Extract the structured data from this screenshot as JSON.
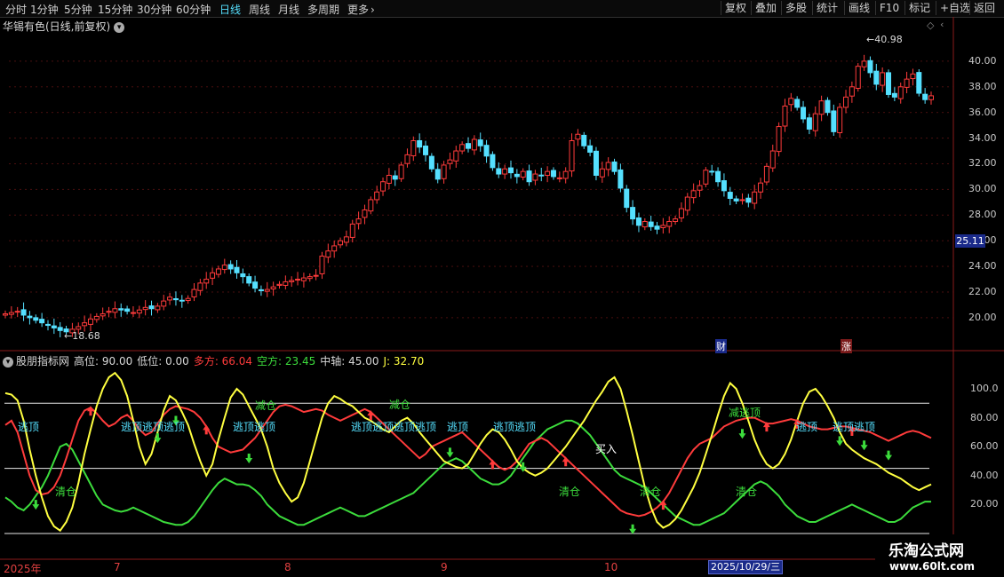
{
  "toolbar": {
    "periods": [
      "分时",
      "1分钟",
      "5分钟",
      "15分钟",
      "30分钟",
      "60分钟",
      "日线",
      "周线",
      "月线",
      "多周期",
      "更多"
    ],
    "active_period": "日线",
    "more_icon": "chevron-right-icon",
    "right_buttons": [
      "复权",
      "叠加",
      "多股",
      "统计",
      "画线",
      "F10",
      "标记",
      "+自选",
      "返回"
    ]
  },
  "stock": {
    "title": "华锡有色(日线,前复权)",
    "high_marker": "40.98",
    "low_marker": "18.68",
    "current_price_tag": "25.11",
    "event_markers": [
      "财",
      "涨"
    ]
  },
  "price_axis": [
    "40.00",
    "38.00",
    "36.00",
    "34.00",
    "32.00",
    "30.00",
    "28.00",
    "26.00",
    "24.00",
    "22.00",
    "20.00"
  ],
  "indicator": {
    "name": "股朋指标网",
    "params": [
      {
        "label": "高位: 90.00",
        "color": "#d8d8d8"
      },
      {
        "label": "低位: 0.00",
        "color": "#d8d8d8"
      },
      {
        "label": "多方: 66.04",
        "color": "#ff3b3b"
      },
      {
        "label": "空方: 23.45",
        "color": "#3cdc3c"
      },
      {
        "label": "中轴: 45.00",
        "color": "#d8d8d8"
      },
      {
        "label": "J: 32.70",
        "color": "#ffff40"
      }
    ],
    "axis": [
      "100.0",
      "80.00",
      "60.00",
      "40.00",
      "20.00"
    ],
    "signals": [
      {
        "text": "逃顶",
        "color": "#55e0ff"
      },
      {
        "text": "清仓",
        "color": "#3cdc3c"
      },
      {
        "text": "逃顶逃顶逃顶",
        "color": "#55e0ff"
      },
      {
        "text": "逃顶逃顶",
        "color": "#55e0ff"
      },
      {
        "text": "减仓",
        "color": "#3cdc3c"
      },
      {
        "text": "逃顶逃顶逃顶逃顶",
        "color": "#55e0ff"
      },
      {
        "text": "减仓",
        "color": "#3cdc3c"
      },
      {
        "text": "逃顶",
        "color": "#55e0ff"
      },
      {
        "text": "逃顶逃顶",
        "color": "#55e0ff"
      },
      {
        "text": "清仓",
        "color": "#3cdc3c"
      },
      {
        "text": "买入",
        "color": "#ffffff"
      },
      {
        "text": "清仓",
        "color": "#3cdc3c"
      },
      {
        "text": "减逃顶",
        "color": "#3cdc3c"
      },
      {
        "text": "清仓",
        "color": "#3cdc3c"
      },
      {
        "text": "逃顶",
        "color": "#55e0ff"
      },
      {
        "text": "逃顶逃顶",
        "color": "#55e0ff"
      }
    ]
  },
  "date_axis": {
    "labels": [
      "2025年",
      "7",
      "8",
      "9",
      "10"
    ],
    "highlight": "2025/10/29/三"
  },
  "watermark": {
    "title": "乐淘公式网",
    "url": "www.60lt.com"
  },
  "colors": {
    "up": "#ff3b3b",
    "down": "#55e0ff",
    "bull_line": "#ff3b3b",
    "bear_line": "#3cdc3c",
    "j_line": "#ffff40",
    "background": "#000000"
  },
  "chart_data": {
    "type": "candlestick",
    "ylim": [
      17.5,
      42
    ],
    "closes": [
      20.3,
      20.4,
      20.5,
      20.2,
      20.0,
      19.8,
      19.6,
      19.4,
      19.2,
      19.0,
      18.9,
      19.1,
      19.3,
      19.6,
      19.9,
      20.1,
      20.3,
      20.5,
      20.7,
      20.6,
      20.5,
      20.4,
      20.6,
      20.8,
      20.7,
      20.9,
      21.3,
      21.6,
      21.4,
      21.3,
      21.5,
      22.2,
      22.7,
      23.0,
      23.5,
      23.8,
      24.1,
      23.8,
      23.5,
      23.2,
      22.7,
      22.3,
      22.1,
      22.2,
      22.4,
      22.6,
      22.8,
      22.9,
      23.0,
      23.1,
      23.2,
      23.3,
      24.8,
      25.2,
      25.6,
      26.0,
      26.3,
      27.3,
      27.7,
      28.4,
      29.2,
      29.8,
      30.6,
      31.1,
      30.8,
      31.9,
      32.7,
      33.8,
      33.3,
      32.7,
      31.6,
      30.8,
      31.9,
      32.3,
      33.0,
      33.5,
      33.2,
      33.9,
      33.4,
      32.6,
      31.7,
      31.2,
      31.6,
      31.3,
      31.0,
      31.4,
      30.6,
      31.2,
      31.1,
      31.4,
      31.0,
      30.9,
      31.4,
      33.8,
      34.3,
      33.4,
      32.9,
      31.1,
      31.6,
      32.1,
      31.4,
      30.1,
      28.6,
      27.7,
      27.2,
      27.5,
      27.1,
      26.9,
      27.2,
      27.5,
      27.7,
      28.5,
      29.4,
      29.9,
      30.3,
      31.5,
      31.4,
      30.6,
      29.9,
      29.3,
      29.1,
      29.2,
      29.0,
      29.8,
      30.5,
      31.8,
      33.0,
      34.9,
      36.5,
      37.1,
      36.4,
      35.5,
      34.7,
      35.9,
      36.9,
      36.0,
      34.5,
      36.4,
      37.2,
      38.0,
      39.6,
      40.0,
      39.1,
      38.2,
      39.1,
      37.4,
      37.2,
      38.0,
      38.6,
      39.0,
      37.5,
      37.0,
      37.3
    ],
    "j": [
      97,
      96,
      92,
      78,
      58,
      40,
      25,
      12,
      5,
      2,
      8,
      18,
      35,
      55,
      72,
      88,
      100,
      108,
      111,
      106,
      95,
      78,
      60,
      48,
      55,
      70,
      85,
      95,
      92,
      84,
      75,
      62,
      50,
      40,
      48,
      65,
      80,
      94,
      100,
      96,
      88,
      80,
      72,
      60,
      45,
      35,
      28,
      22,
      25,
      35,
      50,
      65,
      80,
      90,
      95,
      93,
      90,
      88,
      84,
      80,
      78,
      75,
      72,
      70,
      74,
      78,
      80,
      76,
      70,
      65,
      60,
      55,
      50,
      48,
      46,
      45,
      48,
      55,
      62,
      68,
      72,
      70,
      65,
      58,
      50,
      45,
      42,
      40,
      42,
      45,
      50,
      55,
      60,
      66,
      72,
      78,
      85,
      92,
      98,
      105,
      108,
      100,
      85,
      68,
      50,
      32,
      18,
      8,
      4,
      6,
      10,
      16,
      24,
      32,
      42,
      55,
      68,
      82,
      95,
      104,
      100,
      90,
      78,
      65,
      55,
      48,
      45,
      48,
      55,
      65,
      78,
      90,
      98,
      100,
      95,
      88,
      80,
      70,
      62,
      58,
      55,
      52,
      50,
      48,
      45,
      42,
      40,
      38,
      35,
      32,
      30,
      32,
      34
    ],
    "bull": [
      75,
      78,
      70,
      55,
      40,
      30,
      27,
      28,
      32,
      40,
      52,
      65,
      78,
      85,
      87,
      83,
      78,
      74,
      76,
      80,
      82,
      78,
      72,
      68,
      70,
      76,
      82,
      86,
      88,
      87,
      86,
      84,
      80,
      74,
      66,
      60,
      58,
      56,
      57,
      58,
      62,
      66,
      72,
      78,
      84,
      88,
      89,
      88,
      86,
      84,
      85,
      86,
      85,
      82,
      80,
      78,
      80,
      82,
      84,
      86,
      84,
      80,
      76,
      72,
      68,
      64,
      60,
      56,
      52,
      55,
      60,
      62,
      64,
      66,
      68,
      70,
      66,
      62,
      58,
      54,
      50,
      46,
      44,
      46,
      50,
      56,
      62,
      64,
      66,
      64,
      60,
      56,
      52,
      48,
      44,
      40,
      36,
      32,
      28,
      24,
      20,
      16,
      14,
      13,
      12,
      13,
      15,
      18,
      22,
      28,
      36,
      44,
      52,
      58,
      62,
      64,
      66,
      70,
      74,
      76,
      78,
      79,
      80,
      80,
      78,
      76,
      76,
      77,
      78,
      79,
      78,
      76,
      74,
      73,
      72,
      72,
      73,
      74,
      74,
      73,
      72,
      71,
      70,
      68,
      66,
      64,
      66,
      68,
      70,
      71,
      70,
      68,
      66
    ],
    "bear": [
      25,
      22,
      18,
      16,
      20,
      26,
      32,
      40,
      50,
      60,
      62,
      58,
      50,
      42,
      34,
      26,
      20,
      18,
      16,
      15,
      16,
      18,
      16,
      14,
      12,
      10,
      8,
      7,
      6,
      6,
      8,
      12,
      18,
      24,
      30,
      35,
      38,
      36,
      34,
      34,
      33,
      30,
      26,
      20,
      16,
      12,
      10,
      8,
      6,
      6,
      8,
      10,
      12,
      14,
      16,
      18,
      16,
      14,
      12,
      12,
      14,
      16,
      18,
      20,
      22,
      24,
      26,
      28,
      32,
      36,
      40,
      44,
      48,
      50,
      52,
      50,
      46,
      42,
      38,
      36,
      34,
      34,
      36,
      40,
      46,
      52,
      58,
      64,
      68,
      72,
      74,
      76,
      78,
      78,
      76,
      72,
      68,
      62,
      56,
      50,
      44,
      40,
      38,
      36,
      34,
      32,
      28,
      24,
      20,
      16,
      12,
      10,
      8,
      6,
      6,
      8,
      10,
      12,
      14,
      18,
      22,
      26,
      30,
      34,
      36,
      34,
      30,
      26,
      20,
      16,
      12,
      10,
      8,
      8,
      10,
      12,
      14,
      16,
      18,
      20,
      18,
      16,
      14,
      12,
      10,
      8,
      8,
      10,
      14,
      18,
      20,
      22,
      22
    ]
  }
}
